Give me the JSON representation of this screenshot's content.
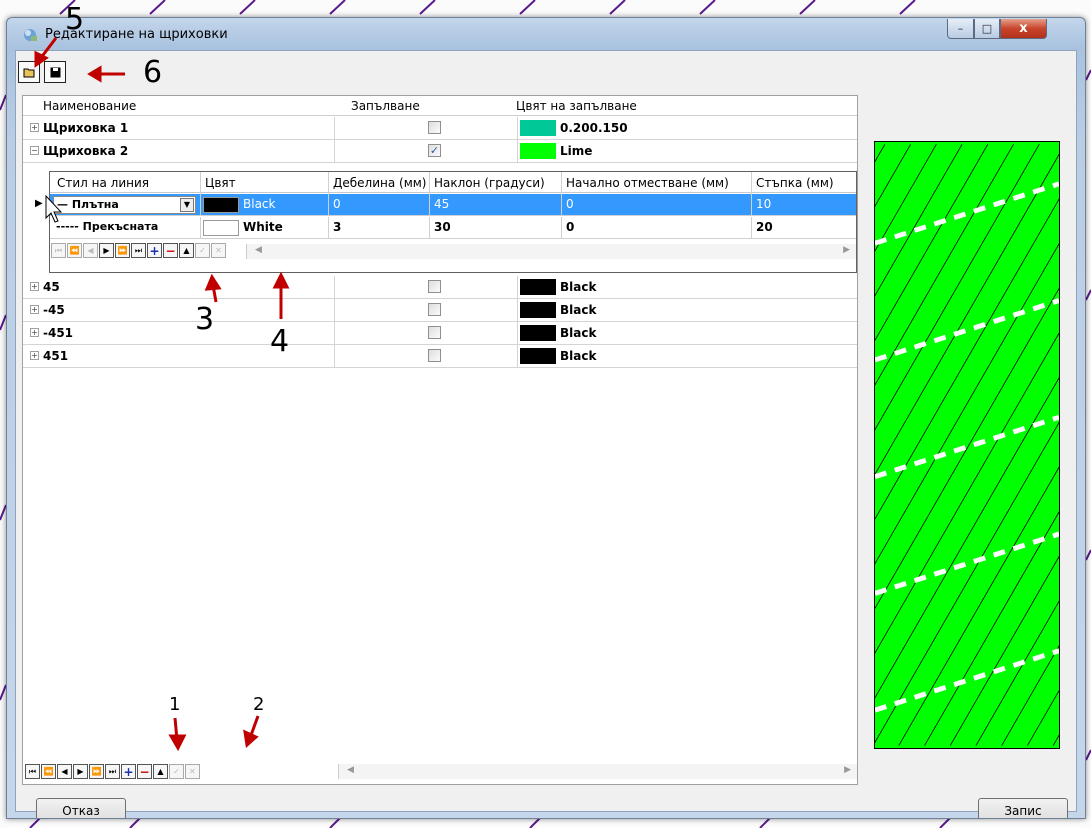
{
  "window": {
    "title": "Редактиране на щриховки",
    "buttons": {
      "minimize": "–",
      "maximize": "□",
      "close": "x"
    }
  },
  "toolbar": {
    "open_icon": "open-folder-icon",
    "save_icon": "floppy-disk-icon"
  },
  "grid": {
    "columns": [
      "Наименование",
      "Запълване",
      "Цвят на запълване"
    ],
    "rows": [
      {
        "expander": "+",
        "name": "Щриховка 1",
        "fill": false,
        "color_hex": "#00c896",
        "color_label": "0.200.150"
      },
      {
        "expander": "−",
        "name": "Щриховка 2",
        "fill": true,
        "color_hex": "#00ff00",
        "color_label": "Lime"
      },
      {
        "expander": "+",
        "name": "45",
        "fill": false,
        "color_hex": "#000000",
        "color_label": "Black"
      },
      {
        "expander": "+",
        "name": "-45",
        "fill": false,
        "color_hex": "#000000",
        "color_label": "Black"
      },
      {
        "expander": "+",
        "name": "-451",
        "fill": false,
        "color_hex": "#000000",
        "color_label": "Black"
      },
      {
        "expander": "+",
        "name": "451",
        "fill": false,
        "color_hex": "#000000",
        "color_label": "Black"
      }
    ]
  },
  "subgrid": {
    "columns": [
      "Стил на линия",
      "Цвят",
      "Дебелина (мм)",
      "Наклон (градуси)",
      "Начално отместване  (мм)",
      "Стъпка (мм)"
    ],
    "rows": [
      {
        "style": "— Плътна",
        "color_hex": "#000000",
        "color_label": "Black",
        "thickness": "0",
        "angle": "45",
        "offset": "0",
        "step": "10",
        "selected": true
      },
      {
        "style": "----- Прекъсната",
        "color_hex": "#ffffff",
        "color_label": "White",
        "thickness": "3",
        "angle": "30",
        "offset": "0",
        "step": "20",
        "selected": false
      }
    ]
  },
  "buttons": {
    "cancel": "Отказ",
    "save": "Запис"
  },
  "annotations": {
    "n1": "1",
    "n2": "2",
    "n3": "3",
    "n4": "4",
    "n5": "5",
    "n6": "6"
  },
  "colors": {
    "preview_fill": "#00ff00",
    "selection": "#3399ff",
    "annotation": "#c00000"
  }
}
